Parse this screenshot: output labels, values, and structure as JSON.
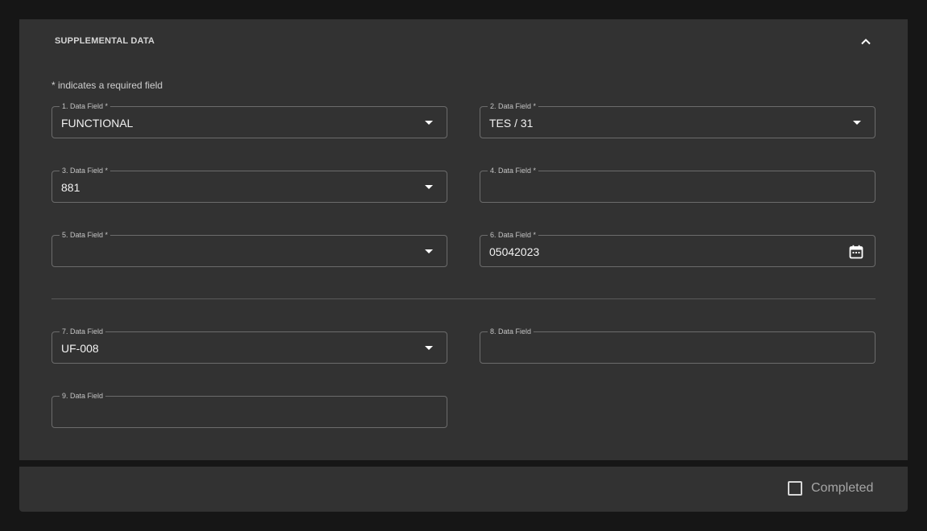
{
  "section": {
    "title": "SUPPLEMENTAL DATA",
    "collapse_icon": "chevron-up-icon",
    "required_note": "* indicates a required field"
  },
  "fields": [
    {
      "label": "1. Data Field *",
      "value": "FUNCTIONAL",
      "type": "select",
      "icon": "dropdown-arrow-icon"
    },
    {
      "label": "2. Data Field *",
      "value": "TES / 31",
      "type": "select",
      "icon": "dropdown-arrow-icon"
    },
    {
      "label": "3. Data Field *",
      "value": "881",
      "type": "select",
      "icon": "dropdown-arrow-icon"
    },
    {
      "label": "4. Data Field *",
      "value": "",
      "type": "text"
    },
    {
      "label": "5. Data Field *",
      "value": "",
      "type": "select",
      "icon": "dropdown-arrow-icon"
    },
    {
      "label": "6. Data Field *",
      "value": "05042023",
      "type": "date",
      "icon": "calendar-icon"
    },
    {
      "label": "7. Data Field",
      "value": "UF-008",
      "type": "select",
      "icon": "dropdown-arrow-icon"
    },
    {
      "label": "8. Data Field",
      "value": "",
      "type": "text"
    },
    {
      "label": "9. Data Field",
      "value": "",
      "type": "text"
    }
  ],
  "footer": {
    "completed_label": "Completed",
    "completed_checked": false
  },
  "colors": {
    "page_background": "#161616",
    "panel_background": "#323232",
    "field_border": "#6c6c6c"
  }
}
